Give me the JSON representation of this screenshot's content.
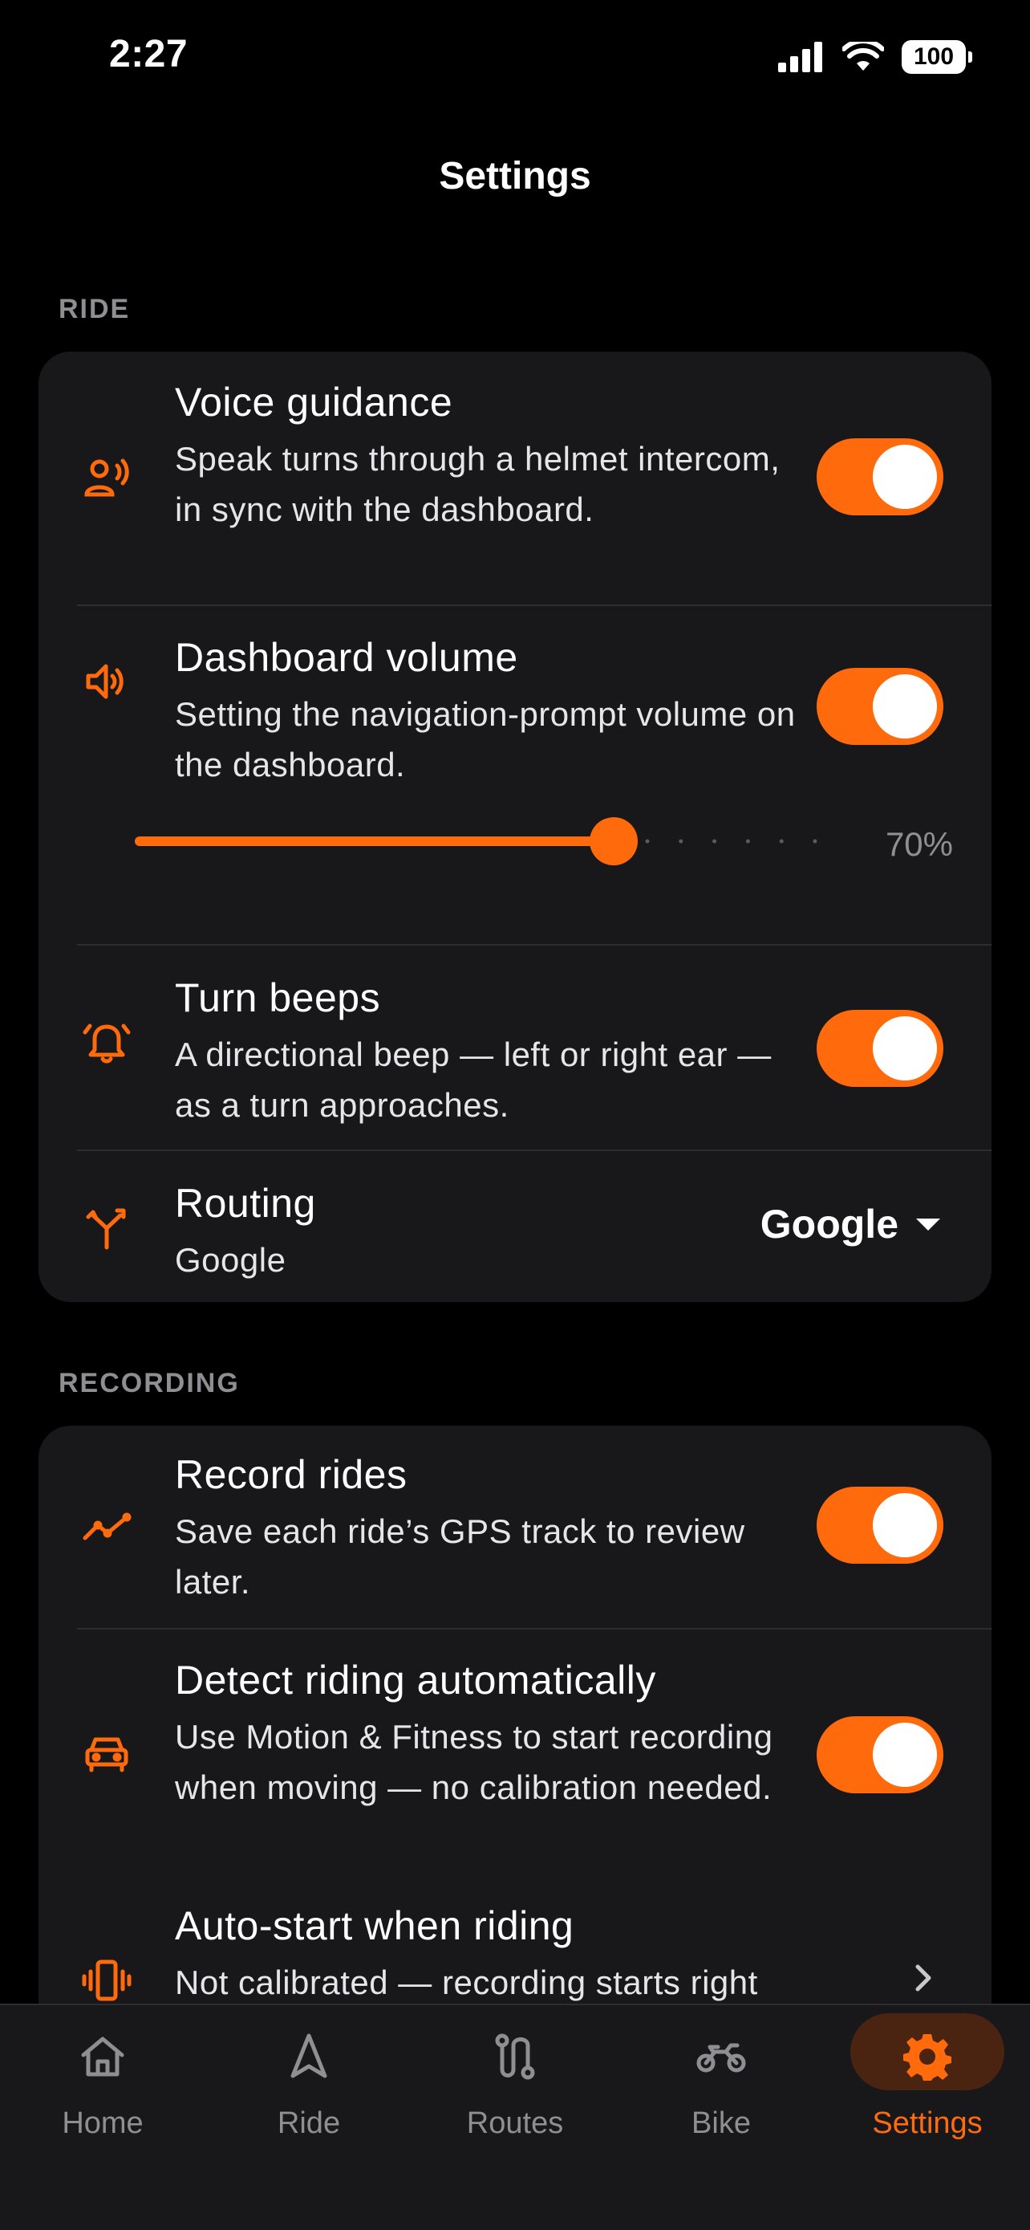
{
  "status_bar": {
    "time": "2:27",
    "battery": "100"
  },
  "page": {
    "title": "Settings"
  },
  "sections": {
    "ride": {
      "header": "RIDE",
      "voice_guidance": {
        "title": "Voice guidance",
        "desc": "Speak turns through a helmet intercom, in sync with the dashboard.",
        "enabled": true,
        "icon": "voice-icon"
      },
      "dashboard_volume": {
        "title": "Dashboard volume",
        "desc": "Setting the navigation-prompt volume on the dashboard.",
        "enabled": true,
        "icon": "speaker-icon",
        "volume_percent": 70,
        "volume_label": "70%"
      },
      "turn_beeps": {
        "title": "Turn beeps",
        "desc": "A directional beep — left or right ear — as a turn approaches.",
        "enabled": true,
        "icon": "bell-icon"
      },
      "routing": {
        "title": "Routing",
        "subtitle": "Google",
        "selected": "Google",
        "icon": "fork-icon"
      }
    },
    "recording": {
      "header": "RECORDING",
      "record_rides": {
        "title": "Record rides",
        "desc": "Save each ride’s GPS track to review later.",
        "enabled": true,
        "icon": "trend-icon"
      },
      "detect_riding": {
        "title": "Detect riding automatically",
        "desc": "Use Motion & Fitness to start recording when moving — no calibration needed.",
        "enabled": true,
        "icon": "car-icon"
      },
      "auto_start": {
        "title": "Auto-start when riding",
        "desc": "Not calibrated — recording starts right",
        "icon": "vibrate-icon"
      }
    }
  },
  "tab_bar": {
    "tabs": [
      {
        "label": "Home",
        "icon": "home-icon",
        "active": false
      },
      {
        "label": "Ride",
        "icon": "navigation-arrow-icon",
        "active": false
      },
      {
        "label": "Routes",
        "icon": "route-icon",
        "active": false
      },
      {
        "label": "Bike",
        "icon": "motorcycle-icon",
        "active": false
      },
      {
        "label": "Settings",
        "icon": "gear-icon",
        "active": true
      }
    ]
  },
  "colors": {
    "accent": "#ff6a0d",
    "card": "#18181a",
    "secondary_text": "#8e8e93",
    "background": "#000000"
  }
}
